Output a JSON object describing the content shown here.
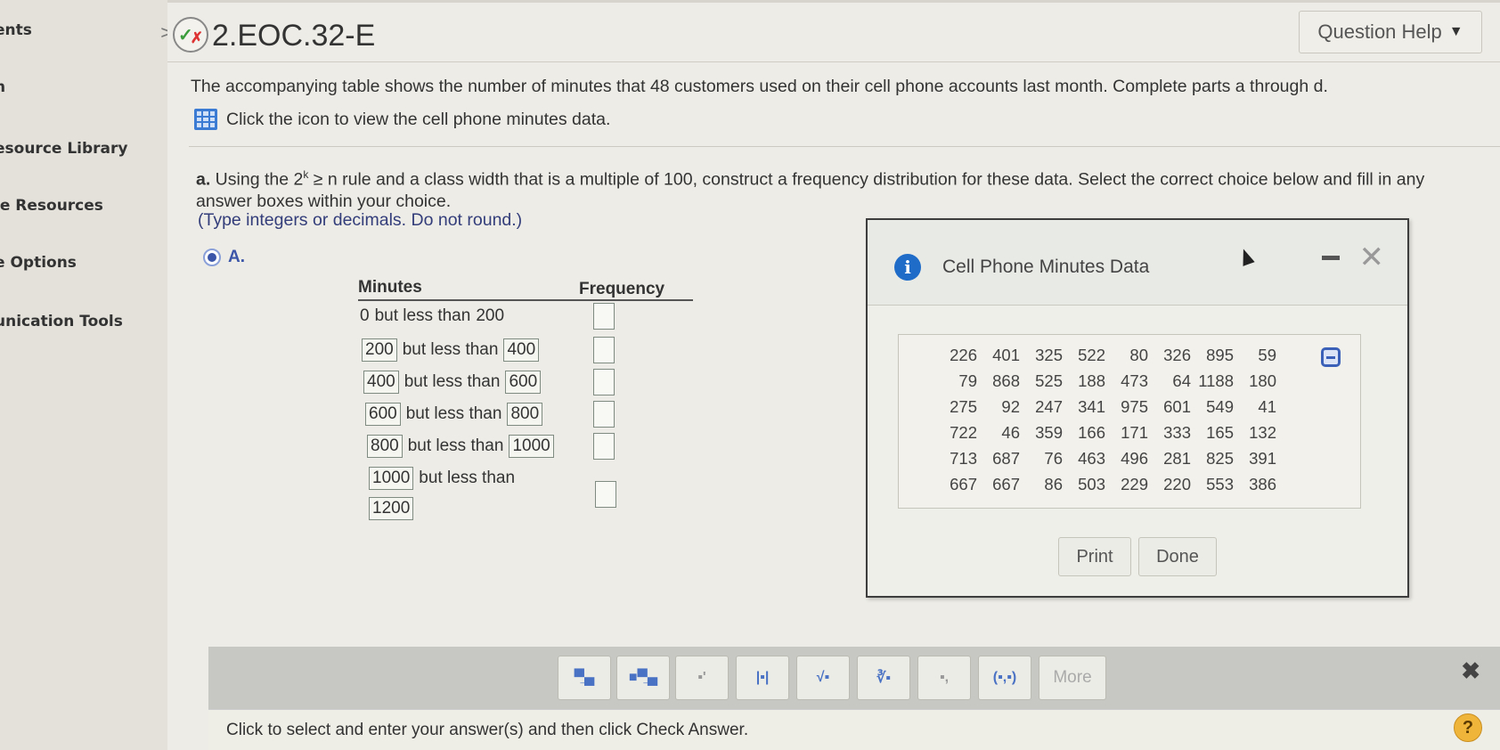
{
  "sidebar": {
    "items": [
      {
        "label": "ents",
        "has_chevron": true
      },
      {
        "label": "n",
        "has_chevron": false
      },
      {
        "label": "esource Library",
        "has_chevron": true
      },
      {
        "label": "le Resources",
        "has_chevron": false
      },
      {
        "label": "e Options",
        "has_chevron": false
      },
      {
        "label": "unication Tools",
        "has_chevron": true
      }
    ],
    "chevron": ">"
  },
  "header": {
    "question_id": "2.EOC.32-E",
    "status_icon": "partial-credit-icon",
    "help_button": "Question Help",
    "help_caret": "▼"
  },
  "question": {
    "intro": "The accompanying table shows the number of minutes that 48 customers used on their cell phone accounts last month. Complete parts a through d.",
    "data_link": "Click the icon to view the cell phone minutes data.",
    "part_label": "a.",
    "part_text_1": " Using the 2",
    "part_sup": "k",
    "part_text_2": " ≥ n rule and a class width that is a multiple of 100, construct a frequency distribution for these data. Select the correct choice below and fill in any answer boxes within your choice.",
    "hint": "(Type integers or decimals. Do not round.)",
    "choice_label": "A.",
    "choice_selected": true
  },
  "freq_table": {
    "headers": [
      "Minutes",
      "Frequency"
    ],
    "connector": "but less than",
    "rows": [
      {
        "low": "0",
        "high": "200",
        "low_editable": false,
        "frequency": ""
      },
      {
        "low": "200",
        "high": "400",
        "low_editable": true,
        "frequency": ""
      },
      {
        "low": "400",
        "high": "600",
        "low_editable": true,
        "frequency": ""
      },
      {
        "low": "600",
        "high": "800",
        "low_editable": true,
        "frequency": ""
      },
      {
        "low": "800",
        "high": "1000",
        "low_editable": true,
        "frequency": ""
      },
      {
        "low": "1000",
        "high": "1200",
        "low_editable": true,
        "frequency": ""
      }
    ]
  },
  "dialog": {
    "title": "Cell Phone Minutes Data",
    "minimize": "—",
    "close": "╳",
    "data": [
      [
        226,
        401,
        325,
        522,
        80,
        326,
        895,
        59
      ],
      [
        79,
        868,
        525,
        188,
        473,
        64,
        1188,
        180
      ],
      [
        275,
        92,
        247,
        341,
        975,
        601,
        549,
        41
      ],
      [
        722,
        46,
        359,
        166,
        171,
        333,
        165,
        132
      ],
      [
        713,
        687,
        76,
        463,
        496,
        281,
        825,
        391
      ],
      [
        667,
        667,
        86,
        503,
        229,
        220,
        553,
        386
      ]
    ],
    "print_label": "Print",
    "done_label": "Done"
  },
  "toolbar": {
    "buttons": [
      {
        "name": "fraction",
        "glyph": "▀̲▄"
      },
      {
        "name": "mixed-number",
        "glyph": "■▀̲▄"
      },
      {
        "name": "exponent",
        "glyph": "▪'"
      },
      {
        "name": "absolute-value",
        "glyph": "|▪|"
      },
      {
        "name": "square-root",
        "glyph": "√▪"
      },
      {
        "name": "nth-root",
        "glyph": "∛▪"
      },
      {
        "name": "subscript",
        "glyph": "▪,"
      },
      {
        "name": "ordered-pair",
        "glyph": "(▪,▪)"
      }
    ],
    "more_label": "More",
    "close": "✖"
  },
  "status": {
    "text": "Click to select and enter your answer(s) and then click Check Answer.",
    "help": "?"
  }
}
